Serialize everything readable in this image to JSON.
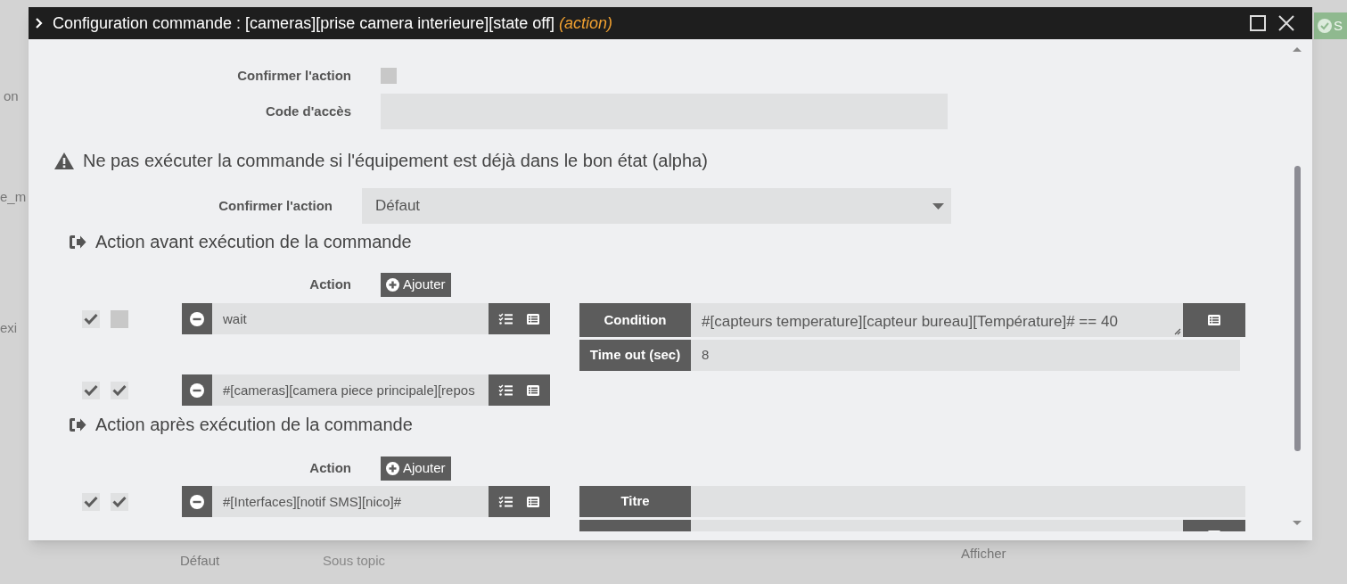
{
  "background": {
    "texts": [
      {
        "text": "on",
        "kind": "left"
      },
      {
        "text": "e_m",
        "kind": "left"
      },
      {
        "text": "exi",
        "kind": "left"
      },
      {
        "text": "Défaut",
        "kind": "select"
      },
      {
        "text": "Sous topic",
        "kind": "placeholder"
      },
      {
        "text": "Afficher",
        "kind": "check"
      }
    ],
    "save_button": "S"
  },
  "dialog": {
    "title": "Configuration commande : [cameras][prise camera interieure][state off]",
    "title_tag": "(action)"
  },
  "confirm_action": {
    "label": "Confirmer l'action",
    "checked": false
  },
  "access_code": {
    "label": "Code d'accès"
  },
  "warning": {
    "text": "Ne pas exécuter la commande si l'équipement est déjà dans le bon état (alpha)"
  },
  "repeat_select": {
    "label": "Confirmer l'action",
    "value": "Défaut"
  },
  "sections": [
    {
      "heading": "Action avant exécution de la commande",
      "action_label": "Action",
      "add_button": "Ajouter",
      "rows": [
        {
          "enabled": true,
          "checked": false,
          "value": "wait",
          "fields": [
            {
              "label": "Condition",
              "value": "#[capteurs temperature][capteur bureau][Température]# == 40",
              "kind": "textarea"
            },
            {
              "label": "Time out (sec)",
              "value": "8",
              "kind": "input"
            }
          ]
        },
        {
          "enabled": true,
          "checked": true,
          "value": "#[cameras][camera piece principale][repos"
        }
      ]
    },
    {
      "heading": "Action après exécution de la commande",
      "action_label": "Action",
      "add_button": "Ajouter",
      "rows": [
        {
          "enabled": true,
          "checked": true,
          "value": "#[Interfaces][notif SMS][nico]#",
          "fields": [
            {
              "label": "Titre",
              "kind": "input"
            },
            {
              "kind": "textarea"
            }
          ]
        }
      ]
    }
  ]
}
